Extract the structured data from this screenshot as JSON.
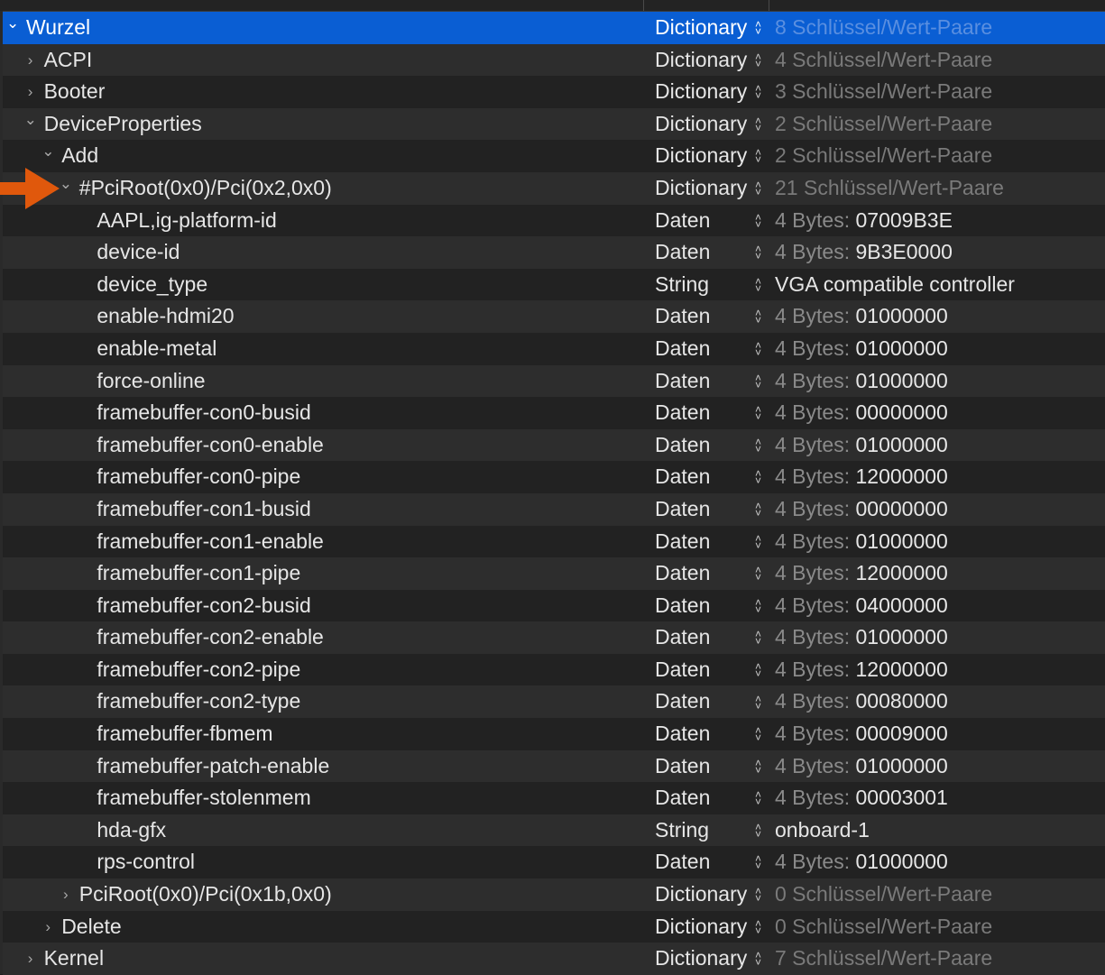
{
  "accent_color": "#0a5ed3",
  "arrow_color": "#e0580c",
  "rows": [
    {
      "key": "Wurzel",
      "level": 0,
      "disclosure": "expanded",
      "type": "Dictionary",
      "value": "8 Schlüssel/Wert-Paare",
      "selected": true
    },
    {
      "key": "ACPI",
      "level": 1,
      "disclosure": "collapsed",
      "type": "Dictionary",
      "value": "4 Schlüssel/Wert-Paare"
    },
    {
      "key": "Booter",
      "level": 1,
      "disclosure": "collapsed",
      "type": "Dictionary",
      "value": "3 Schlüssel/Wert-Paare"
    },
    {
      "key": "DeviceProperties",
      "level": 1,
      "disclosure": "expanded",
      "type": "Dictionary",
      "value": "2 Schlüssel/Wert-Paare"
    },
    {
      "key": "Add",
      "level": 2,
      "disclosure": "expanded",
      "type": "Dictionary",
      "value": "2 Schlüssel/Wert-Paare"
    },
    {
      "key": "#PciRoot(0x0)/Pci(0x2,0x0)",
      "level": 3,
      "disclosure": "expanded",
      "type": "Dictionary",
      "value": "21 Schlüssel/Wert-Paare"
    },
    {
      "key": "AAPL,ig-platform-id",
      "level": 4,
      "type": "Daten",
      "bytes": "4 Bytes:",
      "value": "07009B3E"
    },
    {
      "key": "device-id",
      "level": 4,
      "type": "Daten",
      "bytes": "4 Bytes:",
      "value": "9B3E0000"
    },
    {
      "key": "device_type",
      "level": 4,
      "type": "String",
      "value": "VGA compatible controller"
    },
    {
      "key": "enable-hdmi20",
      "level": 4,
      "type": "Daten",
      "bytes": "4 Bytes:",
      "value": "01000000"
    },
    {
      "key": "enable-metal",
      "level": 4,
      "type": "Daten",
      "bytes": "4 Bytes:",
      "value": "01000000"
    },
    {
      "key": "force-online",
      "level": 4,
      "type": "Daten",
      "bytes": "4 Bytes:",
      "value": "01000000"
    },
    {
      "key": "framebuffer-con0-busid",
      "level": 4,
      "type": "Daten",
      "bytes": "4 Bytes:",
      "value": "00000000"
    },
    {
      "key": "framebuffer-con0-enable",
      "level": 4,
      "type": "Daten",
      "bytes": "4 Bytes:",
      "value": "01000000"
    },
    {
      "key": "framebuffer-con0-pipe",
      "level": 4,
      "type": "Daten",
      "bytes": "4 Bytes:",
      "value": "12000000"
    },
    {
      "key": "framebuffer-con1-busid",
      "level": 4,
      "type": "Daten",
      "bytes": "4 Bytes:",
      "value": "00000000"
    },
    {
      "key": "framebuffer-con1-enable",
      "level": 4,
      "type": "Daten",
      "bytes": "4 Bytes:",
      "value": "01000000"
    },
    {
      "key": "framebuffer-con1-pipe",
      "level": 4,
      "type": "Daten",
      "bytes": "4 Bytes:",
      "value": "12000000"
    },
    {
      "key": "framebuffer-con2-busid",
      "level": 4,
      "type": "Daten",
      "bytes": "4 Bytes:",
      "value": "04000000"
    },
    {
      "key": "framebuffer-con2-enable",
      "level": 4,
      "type": "Daten",
      "bytes": "4 Bytes:",
      "value": "01000000"
    },
    {
      "key": "framebuffer-con2-pipe",
      "level": 4,
      "type": "Daten",
      "bytes": "4 Bytes:",
      "value": "12000000"
    },
    {
      "key": "framebuffer-con2-type",
      "level": 4,
      "type": "Daten",
      "bytes": "4 Bytes:",
      "value": "00080000"
    },
    {
      "key": "framebuffer-fbmem",
      "level": 4,
      "type": "Daten",
      "bytes": "4 Bytes:",
      "value": "00009000"
    },
    {
      "key": "framebuffer-patch-enable",
      "level": 4,
      "type": "Daten",
      "bytes": "4 Bytes:",
      "value": "01000000"
    },
    {
      "key": "framebuffer-stolenmem",
      "level": 4,
      "type": "Daten",
      "bytes": "4 Bytes:",
      "value": "00003001"
    },
    {
      "key": "hda-gfx",
      "level": 4,
      "type": "String",
      "value": "onboard-1"
    },
    {
      "key": "rps-control",
      "level": 4,
      "type": "Daten",
      "bytes": "4 Bytes:",
      "value": "01000000"
    },
    {
      "key": "PciRoot(0x0)/Pci(0x1b,0x0)",
      "level": 3,
      "disclosure": "collapsed",
      "type": "Dictionary",
      "value": "0 Schlüssel/Wert-Paare"
    },
    {
      "key": "Delete",
      "level": 2,
      "disclosure": "collapsed",
      "type": "Dictionary",
      "value": "0 Schlüssel/Wert-Paare"
    },
    {
      "key": "Kernel",
      "level": 1,
      "disclosure": "collapsed",
      "type": "Dictionary",
      "value": "7 Schlüssel/Wert-Paare"
    }
  ]
}
